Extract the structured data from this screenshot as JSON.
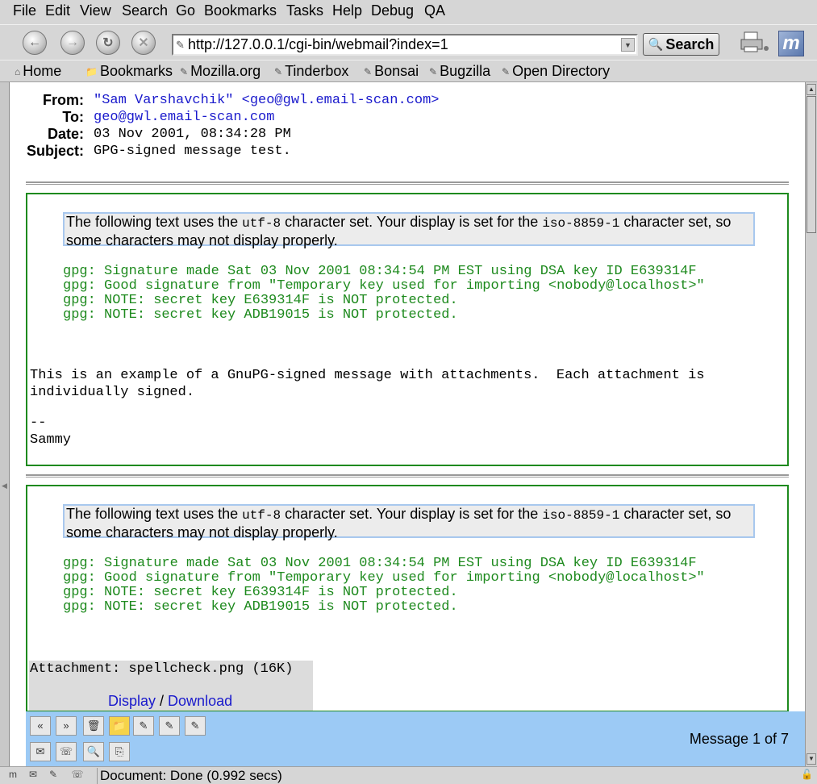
{
  "menubar": {
    "items": [
      "File",
      "Edit",
      "View",
      "Search",
      "Go",
      "Bookmarks",
      "Tasks",
      "Help",
      "Debug",
      "QA"
    ]
  },
  "navbar": {
    "back_icon": "back-arrow-icon",
    "forward_icon": "forward-arrow-icon",
    "reload_icon": "reload-icon",
    "stop_icon": "stop-icon",
    "url": "http://127.0.0.1/cgi-bin/webmail?index=1",
    "search_label": "Search"
  },
  "bookmarks_bar": {
    "items": [
      "Home",
      "Bookmarks",
      "Mozilla.org",
      "Tinderbox",
      "Bonsai",
      "Bugzilla",
      "Open Directory"
    ]
  },
  "message": {
    "from_label": "From:",
    "from_value": "\"Sam Varshavchik\" <geo@gwl.email-scan.com>",
    "to_label": "To:",
    "to_value": "geo@gwl.email-scan.com",
    "date_label": "Date:",
    "date_value": "03 Nov 2001, 08:34:28 PM",
    "subject_label": "Subject:",
    "subject_value": "GPG-signed message test.",
    "charset_pre": "The following text uses the ",
    "charset_text": "utf-8",
    "charset_mid": " character set. Your display is set for the ",
    "charset_display": "iso-8859-1",
    "charset_post": " character set, so some characters may not display properly.",
    "gpg_lines": [
      "gpg: Signature made Sat 03 Nov 2001 08:34:54 PM EST using DSA key ID E639314F",
      "gpg: Good signature from \"Temporary key used for importing <nobody@localhost>\"",
      "gpg: NOTE: secret key E639314F is NOT protected.",
      "gpg: NOTE: secret key ADB19015 is NOT protected."
    ],
    "body_line1": "This is an example of a GnuPG-signed message with attachments.  Each attachment is",
    "body_line2": "individually signed.",
    "sig_sep": "--",
    "sig_name": "Sammy",
    "attachment": {
      "label": "Attachment: spellcheck.png (16K)",
      "display": "Display",
      "separator": " / ",
      "download": "Download"
    }
  },
  "msg_toolbar": {
    "count": "Message 1 of 7"
  },
  "statusbar": {
    "text": "Document: Done (0.992 secs)"
  },
  "colors": {
    "signature_green": "#1e8a1e",
    "link_blue": "#1a1acc",
    "toolbar_blue": "#9ccaf5"
  }
}
